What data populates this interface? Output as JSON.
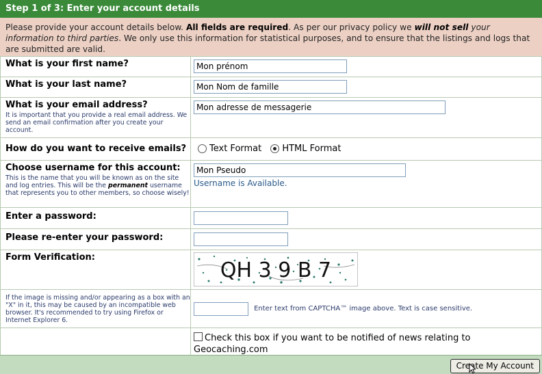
{
  "header": {
    "title": "Step 1 of 3: Enter your account details"
  },
  "intro": {
    "p1": "Please provide your account details below. ",
    "p2": "All fields are required",
    "p3": ". As per our privacy policy we ",
    "p4": "will not sell",
    "p5": " your information to third parties",
    "p6": ". We only use this information for statistical purposes, and to ensure that the listings and logs that are submitted are valid."
  },
  "fields": {
    "first_name": {
      "label": "What is your first name?",
      "value": "Mon prénom"
    },
    "last_name": {
      "label": "What is your last name?",
      "value": "Mon Nom de famille"
    },
    "email": {
      "label": "What is your email address?",
      "help": "It is important that you provide a real email address. We send an email confirmation after you create your account.",
      "value": "Mon adresse de messagerie"
    },
    "email_format": {
      "label": "How do you want to receive emails?",
      "options": [
        "Text Format",
        "HTML Format"
      ],
      "selected": "HTML Format"
    },
    "username": {
      "label": "Choose username for this account:",
      "help_a": "This is the name that you will be known as on the site and log entries. This will be the ",
      "help_b": "permanent",
      "help_c": " username that represents you to other members, so choose wisely!",
      "value": "Mon Pseudo",
      "status": "Username is Available."
    },
    "password": {
      "label": "Enter a password:",
      "value": ""
    },
    "password2": {
      "label": "Please re-enter your password:",
      "value": ""
    },
    "verification": {
      "label": "Form Verification:",
      "captcha_text": "QH 3 9 B 7",
      "help": "If the image is missing and/or appearing as a box with an \"X\" in it, this may be caused by an incompatible web browser. It's recommended to try using Firefox or Internet Explorer 6.",
      "input_value": "",
      "instruction": "Enter text from CAPTCHA™ image above. Text is case sensitive."
    },
    "news": {
      "label": "Check this box if you want to be notified of news relating to Geocaching.com",
      "checked": false
    }
  },
  "footer": {
    "submit_label": "Create My Account"
  },
  "colors": {
    "header_bg": "#3a8a3a",
    "intro_bg": "#ecd0c4",
    "footer_bg": "#c3dcc0"
  }
}
